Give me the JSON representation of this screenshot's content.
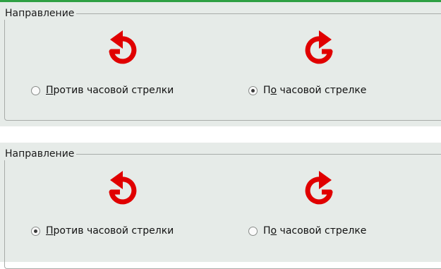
{
  "panels": [
    {
      "title": "Направление",
      "ccw": {
        "mnemonic": "П",
        "rest": "ротив часовой стрелки",
        "checked": false
      },
      "cw": {
        "pre": "П",
        "mnemonic": "о",
        "rest": " часовой стрелке",
        "checked": true
      }
    },
    {
      "title": "Направление",
      "ccw": {
        "mnemonic": "П",
        "rest": "ротив часовой стрелки",
        "checked": true
      },
      "cw": {
        "pre": "П",
        "mnemonic": "о",
        "rest": " часовой стрелке",
        "checked": false
      }
    }
  ],
  "colors": {
    "accent_strip": "#2ea043",
    "arrow": "#e00000",
    "panel_bg": "#e6ebe8"
  },
  "icons": {
    "ccw": "counterclockwise-arrow-icon",
    "cw": "clockwise-arrow-icon"
  }
}
